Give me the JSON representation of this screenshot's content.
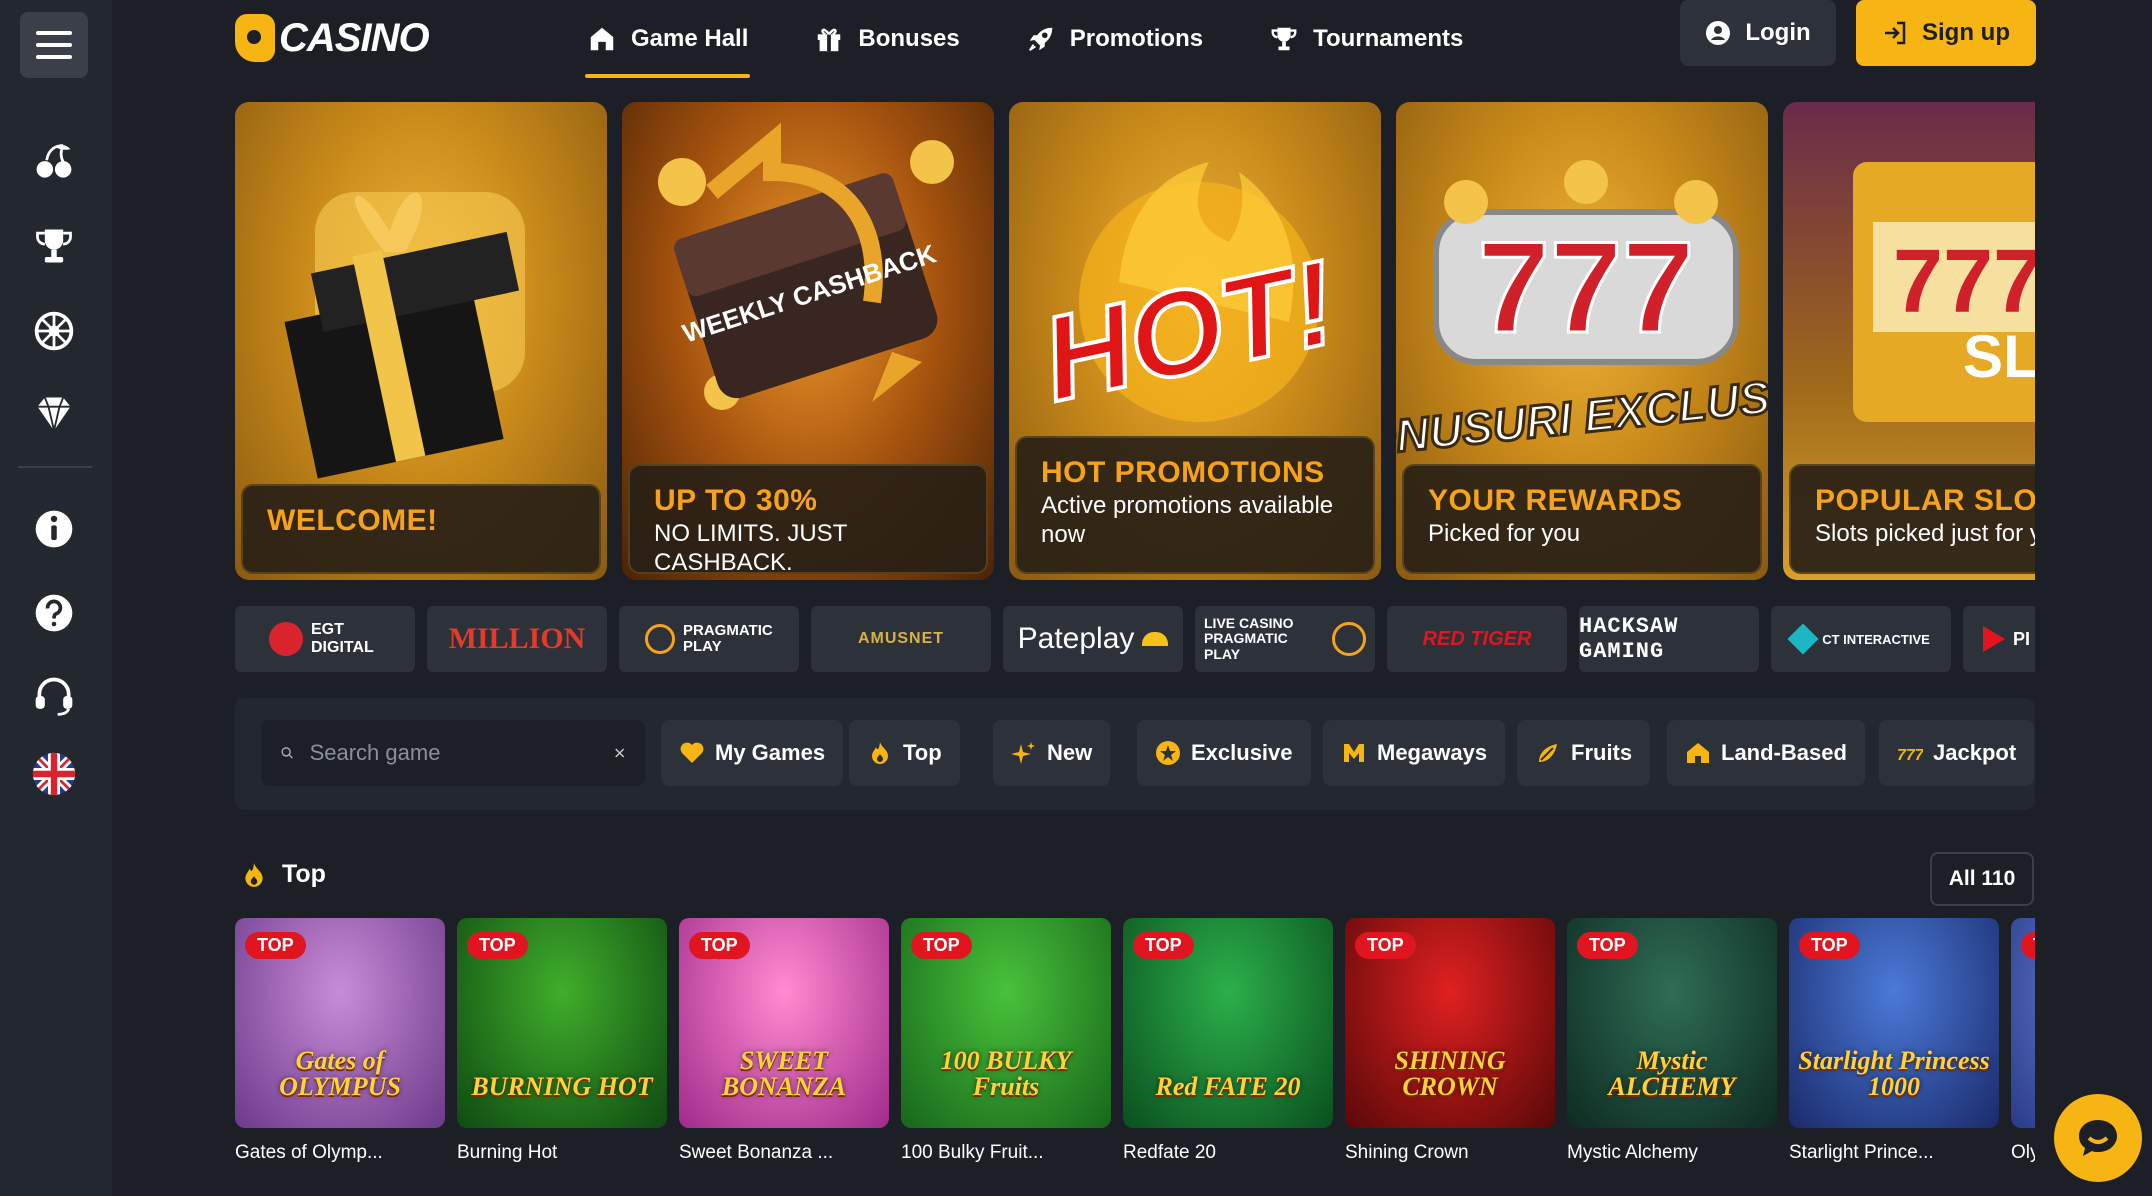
{
  "brand": {
    "logo_text": "CASINO"
  },
  "nav": {
    "items": [
      {
        "label": "Game Hall",
        "icon": "home-icon",
        "active": true
      },
      {
        "label": "Bonuses",
        "icon": "gift-icon"
      },
      {
        "label": "Promotions",
        "icon": "rocket-icon"
      },
      {
        "label": "Tournaments",
        "icon": "trophy-icon"
      }
    ]
  },
  "auth": {
    "login_label": "Login",
    "signup_label": "Sign up"
  },
  "sidebar": {
    "icons": [
      "cherries-icon",
      "trophy-icon",
      "roulette-icon",
      "diamond-icon",
      "info-icon",
      "help-icon",
      "support-icon",
      "uk-flag-icon"
    ]
  },
  "promos": [
    {
      "title": "WELCOME!",
      "subtitle": ""
    },
    {
      "title": "UP TO 30%",
      "subtitle": "NO LIMITS. JUST CASHBACK.",
      "art_text": "WEEKLY CASHBACK"
    },
    {
      "title": "HOT PROMOTIONS",
      "subtitle": "Active promotions available now",
      "art_text": "HOT!"
    },
    {
      "title": "YOUR REWARDS",
      "subtitle": "Picked for you",
      "art_text": "BONUSURI EXCLUSIVE"
    },
    {
      "title": "POPULAR SLOT",
      "subtitle": "Slots picked just for y",
      "art_text": "SLOTU RECOMAND"
    }
  ],
  "providers": [
    {
      "name": "EGT DIGITAL"
    },
    {
      "name": "MILLION"
    },
    {
      "name": "PRAGMATIC PLAY"
    },
    {
      "name": "AMUSNET"
    },
    {
      "name": "Pateplay"
    },
    {
      "name": "LIVE CASINO PRAGMATIC PLAY"
    },
    {
      "name": "RED TIGER"
    },
    {
      "name": "HACKSAW GAMING"
    },
    {
      "name": "CT INTERACTIVE"
    },
    {
      "name": "PI"
    }
  ],
  "search": {
    "placeholder": "Search game"
  },
  "filters": [
    {
      "label": "My Games",
      "icon": "heart-icon"
    },
    {
      "label": "Top",
      "icon": "flame-icon"
    },
    {
      "label": "New",
      "icon": "sparkle-icon"
    },
    {
      "label": "Exclusive",
      "icon": "star-icon"
    },
    {
      "label": "Megaways",
      "icon": "m-icon"
    },
    {
      "label": "Fruits",
      "icon": "fruit-icon"
    },
    {
      "label": "Land-Based",
      "icon": "house-icon"
    },
    {
      "label": "Jackpot",
      "icon": "777-icon"
    }
  ],
  "top_section": {
    "title": "Top",
    "all_label": "All 110"
  },
  "games": [
    {
      "name": "Gates of Olymp...",
      "badge": "TOP",
      "art": "Gates of OLYMPUS",
      "colors": [
        "#c98bd8",
        "#6b3a8a"
      ]
    },
    {
      "name": "Burning Hot",
      "badge": "TOP",
      "art": "BURNING HOT",
      "colors": [
        "#3fae2a",
        "#0f4a12"
      ]
    },
    {
      "name": "Sweet Bonanza ...",
      "badge": "TOP",
      "art": "SWEET BONANZA",
      "colors": [
        "#ff8bd0",
        "#a02a8c"
      ]
    },
    {
      "name": "100 Bulky Fruit...",
      "badge": "TOP",
      "art": "100 BULKY Fruits",
      "colors": [
        "#48c23a",
        "#17661b"
      ]
    },
    {
      "name": "Redfate 20",
      "badge": "TOP",
      "art": "Red FATE 20",
      "colors": [
        "#2bb04a",
        "#0a4f1e"
      ]
    },
    {
      "name": "Shining Crown",
      "badge": "TOP",
      "art": "SHINING CROWN",
      "colors": [
        "#e02020",
        "#5a0808"
      ]
    },
    {
      "name": "Mystic Alchemy",
      "badge": "TOP",
      "art": "Mystic ALCHEMY",
      "colors": [
        "#2e6d55",
        "#0e2a22"
      ]
    },
    {
      "name": "Starlight Prince...",
      "badge": "TOP",
      "art": "Starlight Princess 1000",
      "colors": [
        "#4a7ad8",
        "#1a2a6a"
      ]
    },
    {
      "name": "Oly",
      "badge": "TOP",
      "art": "",
      "colors": [
        "#6a88d8",
        "#2a3a88"
      ]
    }
  ]
}
